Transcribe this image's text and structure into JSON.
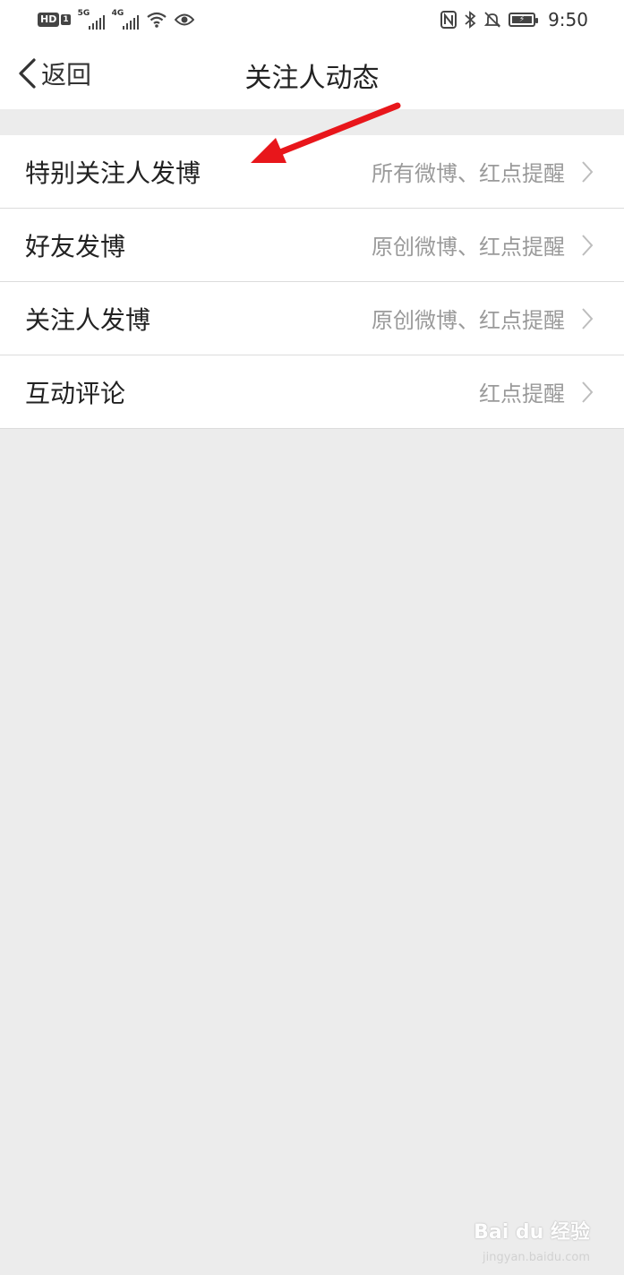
{
  "status_bar": {
    "hd_label": "HD",
    "sim_label": "1",
    "net1": "5G",
    "net2": "4G",
    "time": "9:50"
  },
  "nav": {
    "back_label": "返回",
    "title": "关注人动态"
  },
  "rows": [
    {
      "label": "特别关注人发博",
      "value": "所有微博、红点提醒"
    },
    {
      "label": "好友发博",
      "value": "原创微博、红点提醒"
    },
    {
      "label": "关注人发博",
      "value": "原创微博、红点提醒"
    },
    {
      "label": "互动评论",
      "value": "红点提醒"
    }
  ],
  "annotation": {
    "arrow_color": "#e8161b"
  },
  "watermark": {
    "text": "Bai du 经验",
    "sub": "jingyan.baidu.com"
  }
}
